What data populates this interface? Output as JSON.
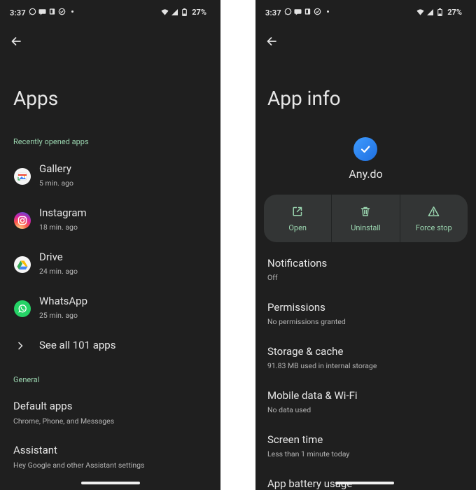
{
  "status_bar": {
    "time": "3:37",
    "battery": "27%"
  },
  "left": {
    "title": "Apps",
    "recent_label": "Recently opened apps",
    "recent_apps": [
      {
        "name": "Gallery",
        "time": "5 min. ago",
        "icon": "gallery-icon"
      },
      {
        "name": "Instagram",
        "time": "18 min. ago",
        "icon": "instagram-icon"
      },
      {
        "name": "Drive",
        "time": "24 min. ago",
        "icon": "drive-icon"
      },
      {
        "name": "WhatsApp",
        "time": "25 min. ago",
        "icon": "whatsapp-icon"
      }
    ],
    "see_all": "See all 101 apps",
    "general_label": "General",
    "settings": [
      {
        "title": "Default apps",
        "subtitle": "Chrome, Phone, and Messages"
      },
      {
        "title": "Assistant",
        "subtitle": "Hey Google and other Assistant settings"
      }
    ]
  },
  "right": {
    "title": "App info",
    "app_name": "Any.do",
    "actions": [
      {
        "label": "Open",
        "icon": "open-external-icon"
      },
      {
        "label": "Uninstall",
        "icon": "trash-icon"
      },
      {
        "label": "Force stop",
        "icon": "warning-icon"
      }
    ],
    "rows": [
      {
        "title": "Notifications",
        "subtitle": "Off"
      },
      {
        "title": "Permissions",
        "subtitle": "No permissions granted"
      },
      {
        "title": "Storage & cache",
        "subtitle": "91.83 MB used in internal storage"
      },
      {
        "title": "Mobile data & Wi-Fi",
        "subtitle": "No data used"
      },
      {
        "title": "Screen time",
        "subtitle": "Less than 1 minute today"
      },
      {
        "title": "App battery usage",
        "subtitle": ""
      }
    ]
  },
  "colors": {
    "background": "#1f1f1f",
    "accent_green": "#9bd6b0",
    "action_bar": "#333535",
    "anydo_blue": "#2a84f5"
  }
}
